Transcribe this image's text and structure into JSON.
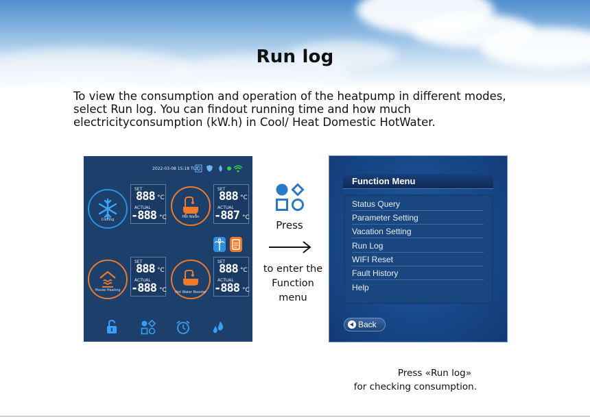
{
  "page": {
    "title": "Run log",
    "intro": "To view the consumption and operation of the heatpump in different modes, select Run log. You can findout running time and how much electricityconsumption (kW.h) in Cool/ Heat Domestic HotWater."
  },
  "device_screen": {
    "datetime": "2022-03-08 15:18  TUE",
    "modes": [
      {
        "label": "Cooling",
        "set_label": "SET",
        "set_value": "888",
        "actual_label": "ACTUAL",
        "actual_value": "-888",
        "unit": "°C",
        "accent": "#2f8fe0"
      },
      {
        "label": "Hot Water",
        "set_label": "SET",
        "set_value": "888",
        "actual_label": "ACTUAL",
        "actual_value": "-887",
        "unit": "°C",
        "accent": "#f07a2a"
      },
      {
        "label": "House Heating",
        "set_label": "SET",
        "set_value": "888",
        "actual_label": "ACTUAL",
        "actual_value": "-888",
        "unit": "°C",
        "accent": "#f07a2a"
      },
      {
        "label": "Hot Water Booster",
        "set_label": "SET",
        "set_value": "888",
        "actual_label": "ACTUAL",
        "actual_value": "-888",
        "unit": "°C",
        "accent": "#f07a2a"
      }
    ],
    "toolbar_icons": [
      "unlock-icon",
      "function-menu-icon",
      "alarm-clock-icon",
      "water-drops-icon"
    ]
  },
  "middle": {
    "press_label": "Press",
    "instruction": "to enter the Function menu"
  },
  "function_menu": {
    "title": "Function Menu",
    "items": [
      "Status Query",
      "Parameter Setting",
      "Vacation Setting",
      "Run Log",
      "WIFI Reset",
      "Fault History",
      "Help"
    ],
    "back_label": "Back"
  },
  "caption": {
    "line1": "Press «Run log»",
    "line2": "for checking consumption."
  },
  "colors": {
    "screen_bg": "#1c3f6b",
    "menu_bg": "#17488a",
    "orange_accent": "#f07a2a",
    "blue_accent": "#2f8fe0",
    "icon_blue": "#2a78c8"
  }
}
